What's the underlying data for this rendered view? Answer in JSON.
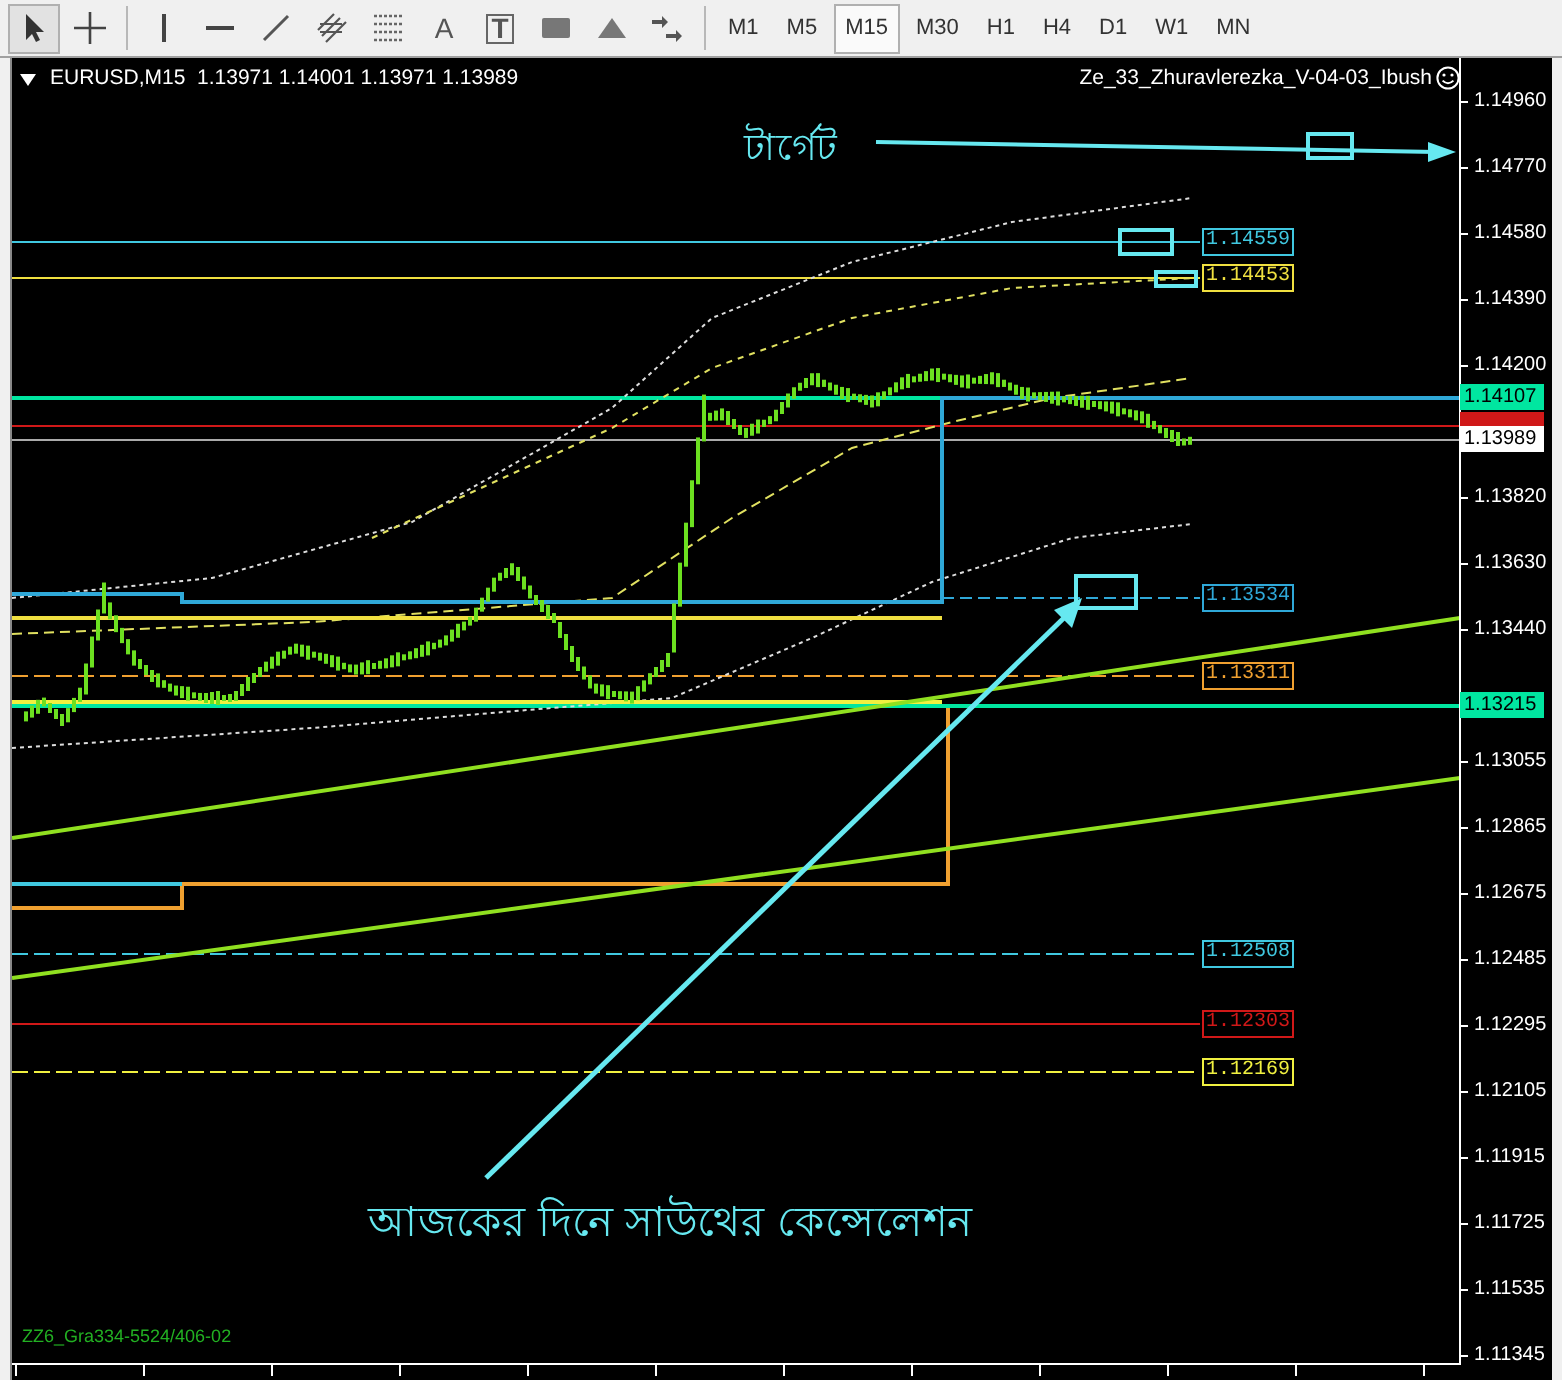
{
  "toolbar": {
    "tools": [
      {
        "kind": "cursor",
        "selected": true
      },
      {
        "kind": "crosshair",
        "selected": false
      },
      {
        "kind": "separator"
      },
      {
        "kind": "vline",
        "selected": false
      },
      {
        "kind": "hline",
        "selected": false
      },
      {
        "kind": "trendline",
        "selected": false
      },
      {
        "kind": "fibo-channel",
        "selected": false
      },
      {
        "kind": "fibo-grid",
        "selected": false
      },
      {
        "kind": "text",
        "label": "A",
        "selected": false
      },
      {
        "kind": "text-label",
        "label": "T",
        "selected": false
      },
      {
        "kind": "rectangle",
        "selected": false
      },
      {
        "kind": "triangle",
        "selected": false
      },
      {
        "kind": "arrows-menu",
        "selected": false
      }
    ],
    "timeframes": [
      {
        "label": "M1",
        "selected": false
      },
      {
        "label": "M5",
        "selected": false
      },
      {
        "label": "M15",
        "selected": true
      },
      {
        "label": "M30",
        "selected": false
      },
      {
        "label": "H1",
        "selected": false
      },
      {
        "label": "H4",
        "selected": false
      },
      {
        "label": "D1",
        "selected": false
      },
      {
        "label": "W1",
        "selected": false
      },
      {
        "label": "MN",
        "selected": false
      }
    ]
  },
  "chart": {
    "header": "EURUSD,M15  1.13971 1.14001 1.13971 1.13989",
    "indicator_name": "Ze_33_Zhuravlerezka_V-04-03_Ibush",
    "footer_label": "ZZ6_Gra334-5524/406-02",
    "price_axis": [
      "1.14960",
      "1.14770",
      "1.14580",
      "1.14390",
      "1.14200",
      "1.13820",
      "1.13630",
      "1.13440",
      "1.13055",
      "1.12865",
      "1.12675",
      "1.12485",
      "1.12295",
      "1.12105",
      "1.11915",
      "1.11725",
      "1.11535",
      "1.11345"
    ],
    "price_markers": [
      {
        "label": "1.14107",
        "color": "#00e6a0"
      },
      {
        "label": "1.13989",
        "color": "#ffffff"
      },
      {
        "label": "1.13215",
        "color": "#00e6a0"
      }
    ],
    "level_labels": [
      {
        "label": "1.14559",
        "color": "#40c8e0"
      },
      {
        "label": "1.14453",
        "color": "#f0e040"
      },
      {
        "label": "1.13534",
        "color": "#2fa8d8"
      },
      {
        "label": "1.13311",
        "color": "#f0a030"
      },
      {
        "label": "1.12508",
        "color": "#40c8e0"
      },
      {
        "label": "1.12303",
        "color": "#d01818"
      },
      {
        "label": "1.12169",
        "color": "#f0f040"
      }
    ],
    "annotations": [
      {
        "text": "টার্গেট"
      },
      {
        "text": "আজকের দিনে সাউথের কেন্সেলেশন"
      }
    ]
  }
}
